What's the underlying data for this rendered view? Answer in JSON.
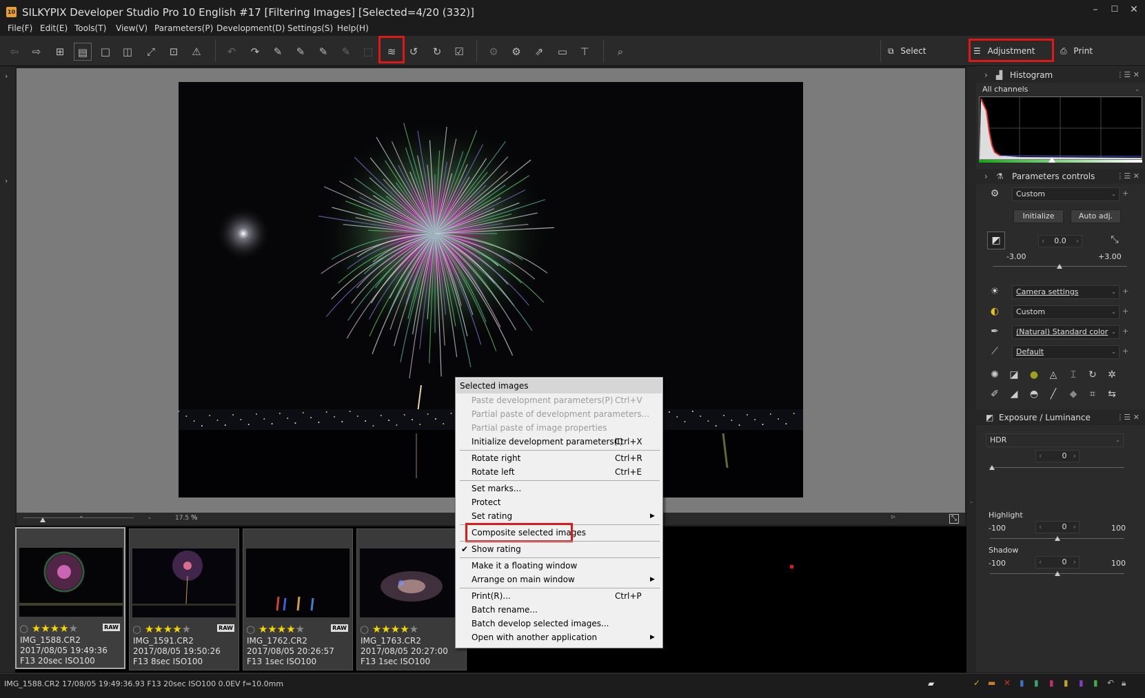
{
  "titlebar": {
    "title": "SILKYPIX Developer Studio Pro 10 English   #17 [Filtering Images]   [Selected=4/20 (332)]",
    "icon_label": "10"
  },
  "menubar": [
    "File(F)",
    "Edit(E)",
    "Tools(T)",
    "View(V)",
    "Parameters(P)",
    "Development(D)",
    "Settings(S)",
    "Help(H)"
  ],
  "modes": {
    "select": "Select",
    "adjustment": "Adjustment",
    "print": "Print"
  },
  "zoom": {
    "value": "17.5",
    "unit": "%"
  },
  "thumbs": [
    {
      "name": "IMG_1588.CR2",
      "date": "2017/08/05 19:49:36",
      "exif": "F13 20sec ISO100",
      "rating": 4,
      "raw": "RAW"
    },
    {
      "name": "IMG_1591.CR2",
      "date": "2017/08/05 19:50:26",
      "exif": "F13 8sec ISO100",
      "rating": 4,
      "raw": "RAW"
    },
    {
      "name": "IMG_1762.CR2",
      "date": "2017/08/05 20:26:57",
      "exif": "F13 1sec ISO100",
      "rating": 4,
      "raw": "RAW"
    },
    {
      "name": "IMG_1763.CR2",
      "date": "2017/08/05 20:27:00",
      "exif": "F13 1sec ISO100",
      "rating": 4,
      "raw": ""
    }
  ],
  "context_menu": {
    "header": "Selected images",
    "paste": "Paste development parameters(P)",
    "paste_sc": "Ctrl+V",
    "partial_dev": "Partial paste of development parameters...",
    "partial_img": "Partial paste of image properties",
    "init": "Initialize development parameters(I)",
    "init_sc": "Ctrl+X",
    "rotate_right": "Rotate right",
    "rotate_right_sc": "Ctrl+R",
    "rotate_left": "Rotate left",
    "rotate_left_sc": "Ctrl+E",
    "set_marks": "Set marks...",
    "protect": "Protect",
    "set_rating": "Set rating",
    "composite": "Composite selected images",
    "show_rating": "Show rating",
    "floating": "Make it a floating window",
    "arrange": "Arrange on main window",
    "print": "Print(R)...",
    "print_sc": "Ctrl+P",
    "batch_rename": "Batch rename...",
    "batch_develop": "Batch develop selected images...",
    "open_with": "Open with another application"
  },
  "status": "IMG_1588.CR2 17/08/05 19:49:36.93 F13 20sec ISO100  0.0EV f=10.0mm",
  "right_panel": {
    "histogram": {
      "title": "Histogram",
      "channel": "All channels"
    },
    "params": {
      "title": "Parameters controls",
      "preset": "Custom",
      "initialize": "Initialize",
      "auto_adj": "Auto adj.",
      "exposure_value": "0.0",
      "exposure_min": "-3.00",
      "exposure_max": "+3.00",
      "white_balance": "Camera settings",
      "tone": "Custom",
      "color": "(Natural) Standard color",
      "sharpness": "Default"
    },
    "exposure": {
      "title": "Exposure / Luminance",
      "mode": "HDR",
      "hdr_value": "0",
      "highlight_label": "Highlight",
      "highlight_min": "-100",
      "highlight_value": "0",
      "highlight_max": "100",
      "shadow_label": "Shadow",
      "shadow_min": "-100",
      "shadow_value": "0",
      "shadow_max": "100"
    }
  },
  "colors": {
    "highlight_box": "#e01818",
    "star": "#f5d800",
    "bg": "#1e1e1e"
  }
}
